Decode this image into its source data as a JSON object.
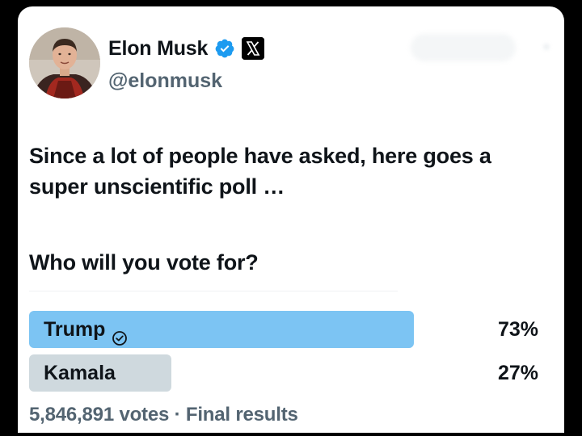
{
  "author": {
    "name": "Elon Musk",
    "handle": "@elonmusk",
    "verified_color": "#1d9bf0"
  },
  "tweet": {
    "text": "Since a lot of people have asked, here goes a super unscientific poll …",
    "question": "Who will you vote for?"
  },
  "poll": {
    "options": [
      {
        "label": "Trump",
        "percent_label": "73%",
        "percent": 73,
        "winner": true,
        "bar_color": "#7cc4f3"
      },
      {
        "label": "Kamala",
        "percent_label": "27%",
        "percent": 27,
        "winner": false,
        "bar_color": "#cfd9de"
      }
    ],
    "votes": "5,846,891 votes",
    "separator": "·",
    "status": "Final results"
  },
  "icons": {
    "verified": "verified-badge-icon",
    "platform": "x-logo-icon",
    "winner": "check-circle-icon"
  }
}
